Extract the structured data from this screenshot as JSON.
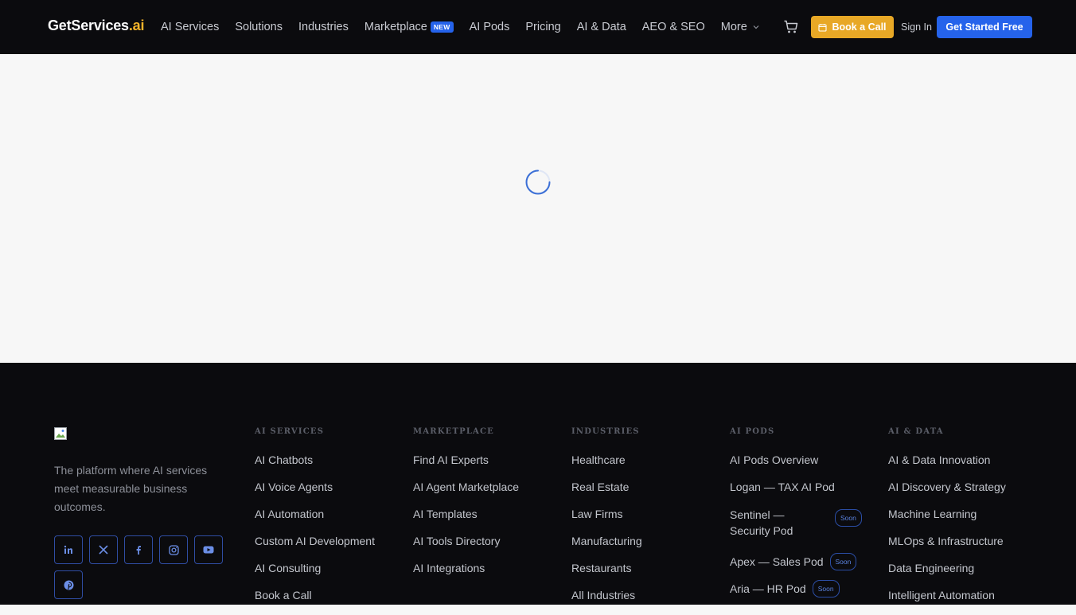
{
  "header": {
    "logo_main": "GetServices",
    "logo_accent": ".ai",
    "menu": [
      "AI Services",
      "Solutions",
      "Industries",
      "Marketplace",
      "AI Pods",
      "Pricing",
      "AI & Data",
      "AEO & SEO",
      "More"
    ],
    "marketplace_badge": "NEW",
    "book_call": "Book a Call",
    "sign_in": "Sign In",
    "get_started": "Get Started Free"
  },
  "footer": {
    "tagline": "The platform where AI services meet measurable business outcomes.",
    "socials": [
      "linkedin-icon",
      "x-icon",
      "facebook-icon",
      "instagram-icon",
      "youtube-icon",
      "pinterest-icon"
    ],
    "columns": [
      {
        "title": "AI SERVICES",
        "links": [
          "AI Chatbots",
          "AI Voice Agents",
          "AI Automation",
          "Custom AI Development",
          "AI Consulting",
          "Book a Call"
        ]
      },
      {
        "title": "MARKETPLACE",
        "links": [
          "Find AI Experts",
          "AI Agent Marketplace",
          "AI Templates",
          "AI Tools Directory",
          "AI Integrations"
        ]
      },
      {
        "title": "INDUSTRIES",
        "links": [
          "Healthcare",
          "Real Estate",
          "Law Firms",
          "Manufacturing",
          "Restaurants",
          "All Industries"
        ]
      },
      {
        "title": "AI PODS",
        "links": [
          "AI Pods Overview",
          "Logan — TAX AI Pod",
          "Sentinel — Security Pod",
          "Apex — Sales Pod",
          "Aria — HR Pod"
        ],
        "soon_label": "Soon"
      },
      {
        "title": "AI & DATA",
        "links": [
          "AI & Data Innovation",
          "AI Discovery & Strategy",
          "Machine Learning",
          "MLOps & Infrastructure",
          "Data Engineering",
          "Intelligent Automation"
        ]
      }
    ]
  },
  "colors": {
    "accent_blue": "#2563eb",
    "accent_gold": "#e8a826",
    "background_dark": "#0b0b0e"
  }
}
